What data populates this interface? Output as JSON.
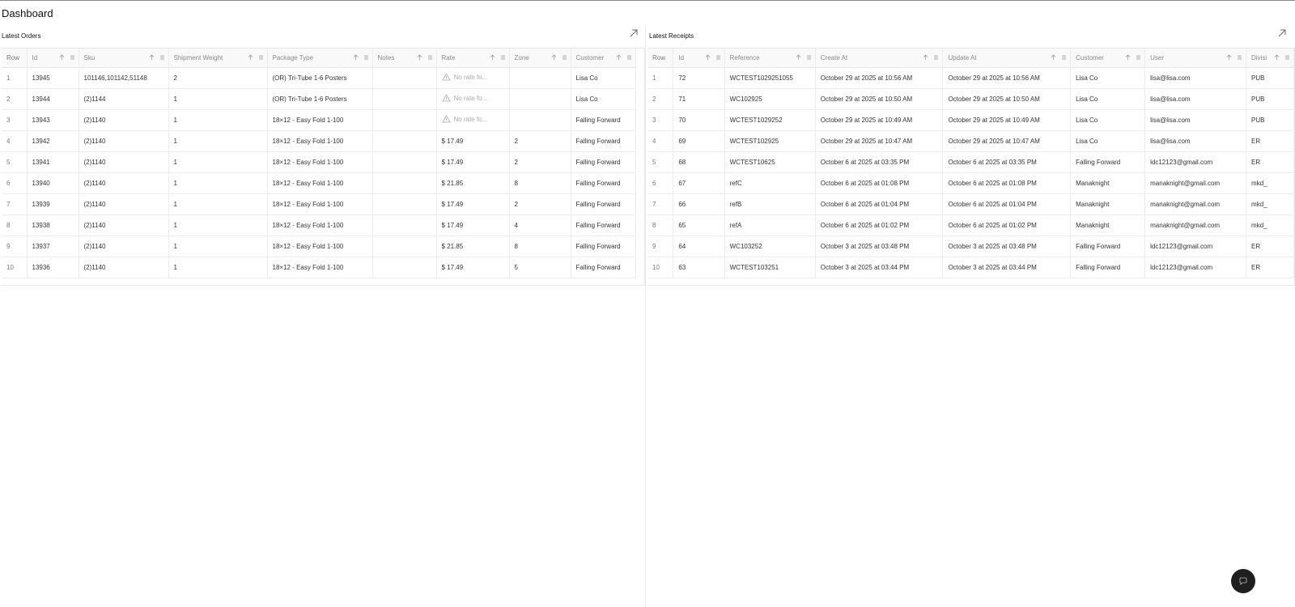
{
  "page": {
    "title": "Dashboard"
  },
  "orders": {
    "title": "Latest Orders",
    "columns": [
      "Row",
      "Id",
      "Sku",
      "Shipment Weight",
      "Package Type",
      "Notes",
      "Rate",
      "Zone",
      "Customer"
    ],
    "rows": [
      [
        "1",
        "13945",
        "101146,101142,51148",
        "2",
        "(OR) Tri-Tube 1-6 Posters",
        "",
        "No rate fo...",
        "",
        "Lisa Co"
      ],
      [
        "2",
        "13944",
        "(2)1144",
        "1",
        "(OR) Tri-Tube 1-6 Posters",
        "",
        "No rate fo...",
        "",
        "Lisa Co"
      ],
      [
        "3",
        "13943",
        "(2)1140",
        "1",
        "18×12 - Easy Fold 1-100",
        "",
        "No rate fo...",
        "",
        "Falling Forward"
      ],
      [
        "4",
        "13942",
        "(2)1140",
        "1",
        "18×12 - Easy Fold 1-100",
        "",
        "$ 17.49",
        "2",
        "Falling Forward"
      ],
      [
        "5",
        "13941",
        "(2)1140",
        "1",
        "18×12 - Easy Fold 1-100",
        "",
        "$ 17.49",
        "2",
        "Falling Forward"
      ],
      [
        "6",
        "13940",
        "(2)1140",
        "1",
        "18×12 - Easy Fold 1-100",
        "",
        "$ 21.85",
        "8",
        "Falling Forward"
      ],
      [
        "7",
        "13939",
        "(2)1140",
        "1",
        "18×12 - Easy Fold 1-100",
        "",
        "$ 17.49",
        "2",
        "Falling Forward"
      ],
      [
        "8",
        "13938",
        "(2)1140",
        "1",
        "18×12 - Easy Fold 1-100",
        "",
        "$ 17.49",
        "4",
        "Falling Forward"
      ],
      [
        "9",
        "13937",
        "(2)1140",
        "1",
        "18×12 - Easy Fold 1-100",
        "",
        "$ 21.85",
        "8",
        "Falling Forward"
      ],
      [
        "10",
        "13936",
        "(2)1140",
        "1",
        "18×12 - Easy Fold 1-100",
        "",
        "$ 17.49",
        "5",
        "Falling Forward"
      ]
    ]
  },
  "receipts": {
    "title": "Latest Receipts",
    "columns": [
      "Row",
      "Id",
      "Reference",
      "Create At",
      "Update At",
      "Customer",
      "User",
      "Divisi"
    ],
    "rows": [
      [
        "1",
        "72",
        "WCTEST1029251055",
        "October 29 at 2025 at 10:56 AM",
        "October 29 at 2025 at 10:56 AM",
        "Lisa Co",
        "lisa@lisa.com",
        "PUB"
      ],
      [
        "2",
        "71",
        "WC102925",
        "October 29 at 2025 at 10:50 AM",
        "October 29 at 2025 at 10:50 AM",
        "Lisa Co",
        "lisa@lisa.com",
        "PUB"
      ],
      [
        "3",
        "70",
        "WCTEST1029252",
        "October 29 at 2025 at 10:49 AM",
        "October 29 at 2025 at 10:49 AM",
        "Lisa Co",
        "lisa@lisa.com",
        "PUB"
      ],
      [
        "4",
        "69",
        "WCTEST102925",
        "October 29 at 2025 at 10:47 AM",
        "October 29 at 2025 at 10:47 AM",
        "Lisa Co",
        "lisa@lisa.com",
        "ER"
      ],
      [
        "5",
        "68",
        "WCTEST10625",
        "October 6 at 2025 at 03:35 PM",
        "October 6 at 2025 at 03:35 PM",
        "Falling Forward",
        "ldc12123@gmail.com",
        "ER"
      ],
      [
        "6",
        "67",
        "refC",
        "October 6 at 2025 at 01:08 PM",
        "October 6 at 2025 at 01:08 PM",
        "Manaknight",
        "manaknight@gmail.com",
        "mkd_"
      ],
      [
        "7",
        "66",
        "refB",
        "October 6 at 2025 at 01:04 PM",
        "October 6 at 2025 at 01:04 PM",
        "Manaknight",
        "manaknight@gmail.com",
        "mkd_"
      ],
      [
        "8",
        "65",
        "refA",
        "October 6 at 2025 at 01:02 PM",
        "October 6 at 2025 at 01:02 PM",
        "Manaknight",
        "manaknight@gmail.com",
        "mkd_"
      ],
      [
        "9",
        "64",
        "WC103252",
        "October 3 at 2025 at 03:48 PM",
        "October 3 at 2025 at 03:48 PM",
        "Falling Forward",
        "ldc12123@gmail.com",
        "ER"
      ],
      [
        "10",
        "63",
        "WCTEST103251",
        "October 3 at 2025 at 03:44 PM",
        "October 3 at 2025 at 03:44 PM",
        "Falling Forward",
        "ldc12123@gmail.com",
        "ER"
      ]
    ]
  },
  "icons": {
    "expand": "arrow-up-right-icon",
    "sort": "sort-arrow-icon",
    "column_menu": "column-menu-icon",
    "warning": "warning-triangle-icon",
    "fab": "chat-bubble-icon"
  },
  "colors": {
    "fab": "#1f1f1f",
    "header_bg": "#f9f9f9",
    "muted_text": "#888888"
  }
}
